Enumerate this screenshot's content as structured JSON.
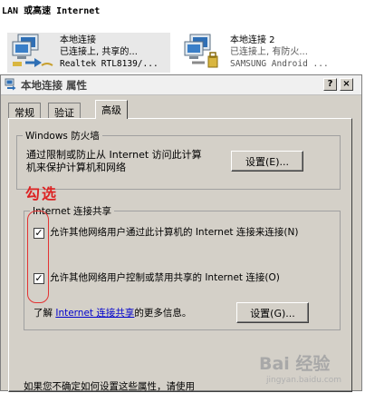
{
  "connections": {
    "header": "LAN 或高速 Internet",
    "items": [
      {
        "name": "本地连接",
        "status": "已连接上, 共享的...",
        "device": "Realtek RTL8139/..."
      },
      {
        "name": "本地连接 2",
        "status": "已连接上, 有防火...",
        "device": "SAMSUNG Android ..."
      }
    ]
  },
  "dialog": {
    "title": "本地连接 属性",
    "help_button": "?",
    "close_button": "×",
    "tabs": [
      "常规",
      "验证",
      "高级"
    ],
    "active_tab": 2,
    "firewall": {
      "group_title": "Windows 防火墙",
      "description_line1": "通过限制或防止从 Internet 访问此计算",
      "description_line2": "机来保护计算机和网络",
      "settings_button": "设置(E)..."
    },
    "ics": {
      "group_title": "Internet 连接共享",
      "option1": "允许其他网络用户通过此计算机的 Internet 连接来连接(N)",
      "option1_checked": true,
      "option2": "允许其他网络用户控制或禁用共享的 Internet 连接(O)",
      "option2_checked": true,
      "learn_prefix": "了解",
      "learn_link": "Internet 连接共享",
      "learn_suffix": "的更多信息。",
      "settings_button": "设置(G)..."
    },
    "bottom_note": "如果您不确定如何设置这些属性，请使用"
  },
  "annotation": {
    "label": "勾选",
    "color": "#dd2222"
  },
  "watermark": {
    "main": "Bai 经验",
    "sub": "jingyan.baidu.com"
  }
}
